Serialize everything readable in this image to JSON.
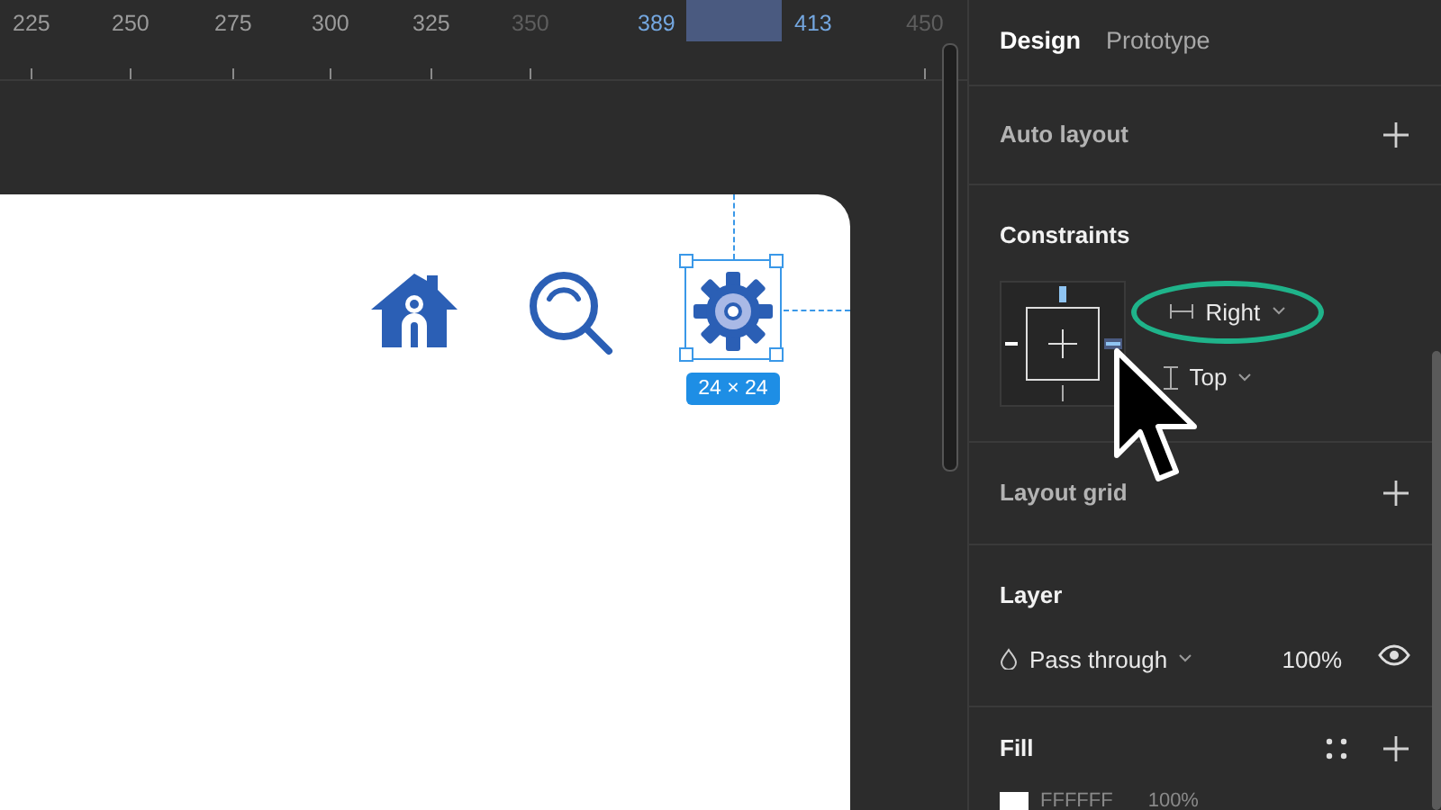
{
  "ruler": {
    "marks": [
      {
        "label": "225",
        "kind": "tick"
      },
      {
        "label": "250",
        "kind": "tick"
      },
      {
        "label": "275",
        "kind": "tick"
      },
      {
        "label": "300",
        "kind": "tick"
      },
      {
        "label": "325",
        "kind": "tick"
      },
      {
        "label": "350",
        "kind": "faded"
      },
      {
        "label": "389",
        "kind": "selection"
      },
      {
        "label": "413",
        "kind": "selection"
      },
      {
        "label": "450",
        "kind": "faded"
      }
    ]
  },
  "canvas": {
    "selection_size": "24 × 24"
  },
  "panel": {
    "tabs": [
      {
        "label": "Design",
        "selected": true
      },
      {
        "label": "Prototype",
        "selected": false
      }
    ],
    "auto_layout": {
      "title": "Auto layout"
    },
    "constraints": {
      "title": "Constraints",
      "horizontal": {
        "value": "Right",
        "circled": true
      },
      "vertical": {
        "value": "Top",
        "circled": false
      }
    },
    "layout_grid": {
      "title": "Layout grid"
    },
    "layer": {
      "title": "Layer",
      "blend_mode": "Pass through",
      "opacity": "100%"
    },
    "fill": {
      "title": "Fill",
      "color": "FFFFFF",
      "opacity": "100%"
    }
  }
}
